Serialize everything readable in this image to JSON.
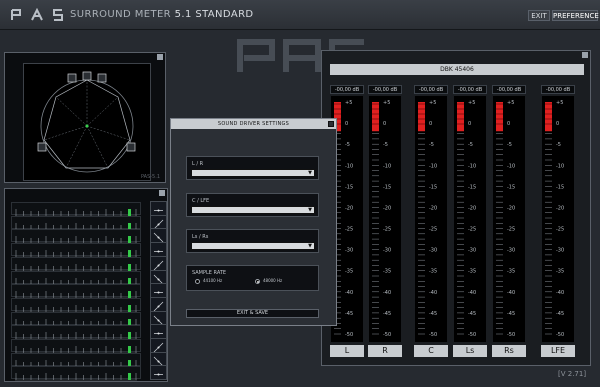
{
  "window": {
    "brand": "P A S",
    "title": "SURROUND METER",
    "title_version": "5.1 STANDARD",
    "exit_label": "EXIT",
    "preferences_label": "PREFERENCE",
    "version": "[V 2.71]"
  },
  "colors": {
    "meter_peak_red": "#e02020",
    "meter_zero_line": "#cc2a2a",
    "phase_green": "#35c94a",
    "panel_bg": "#0b0d10",
    "accent_gray": "#c8ccd0"
  },
  "surround_scope": {
    "speaker_icons": [
      "speaker-l-icon",
      "speaker-c-icon",
      "speaker-r-icon",
      "speaker-ls-icon",
      "speaker-rs-icon"
    ],
    "watermark": "PAS-5.1"
  },
  "phase_meter": {
    "row_count": 13
  },
  "meters": {
    "device_name": "DBK 45406",
    "scale": [
      "+5",
      "0",
      "-5",
      "-10",
      "-15",
      "-20",
      "-25",
      "-30",
      "-35",
      "-40",
      "-45",
      "-50"
    ],
    "channels": [
      {
        "name": "L",
        "peak_readout": "-00,00 dB",
        "level_fraction": 0.06
      },
      {
        "name": "R",
        "peak_readout": "-00,00 dB",
        "level_fraction": 0.06
      },
      {
        "name": "C",
        "peak_readout": "-00,00 dB",
        "level_fraction": 0.06
      },
      {
        "name": "Ls",
        "peak_readout": "-00,00 dB",
        "level_fraction": 0.06
      },
      {
        "name": "Rs",
        "peak_readout": "-00,00 dB",
        "level_fraction": 0.06
      },
      {
        "name": "LFE",
        "peak_readout": "-00,00 dB",
        "level_fraction": 0.06
      }
    ]
  },
  "sound_driver_dialog": {
    "title": "SOUND DRIVER SETTINGS",
    "front_label": "L / R",
    "center_label": "C / LFE",
    "surround_label": "Ls / Rs",
    "front_value": "",
    "center_value": "",
    "surround_value": "",
    "sample_rate_label": "SAMPLE RATE",
    "rate_options": [
      "44100 Hz",
      "48000 Hz"
    ],
    "selected_rate": "48000 Hz",
    "save_label": "EXIT & SAVE"
  }
}
